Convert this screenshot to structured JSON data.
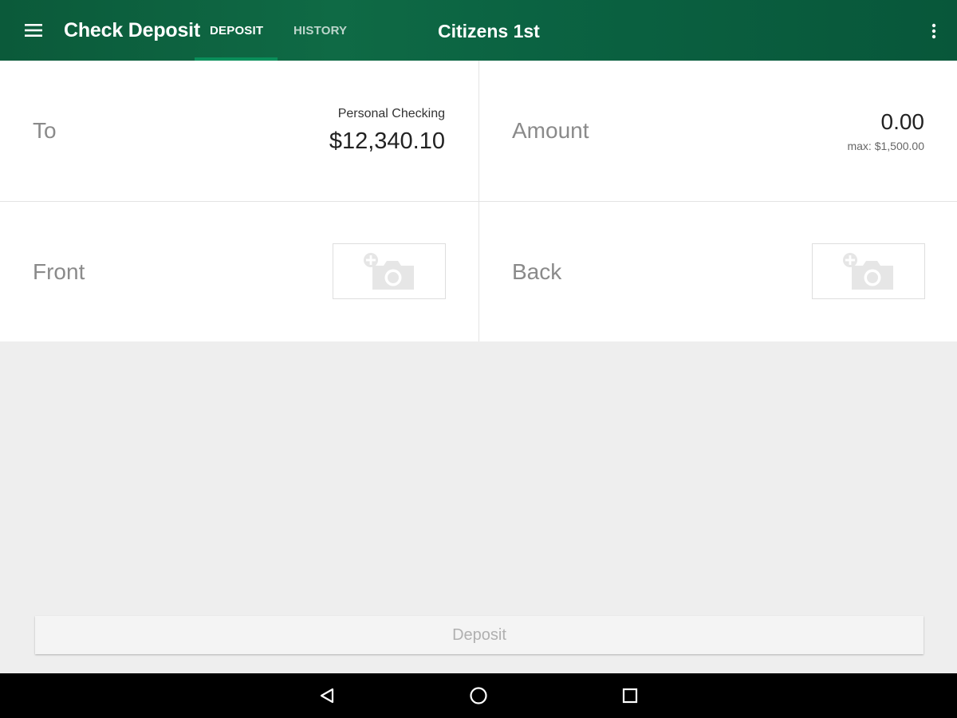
{
  "appbar": {
    "title": "Check Deposit",
    "tabs": [
      {
        "label": "DEPOSIT",
        "active": true
      },
      {
        "label": "HISTORY",
        "active": false
      }
    ],
    "bank_name": "Citizens 1st",
    "menu_icon": "hamburger-menu-icon",
    "overflow_icon": "more-vert-icon",
    "color_start": "#0b5a3a",
    "color_end": "#08573a"
  },
  "form": {
    "to": {
      "label": "To",
      "account_name": "Personal Checking",
      "balance": "$12,340.10"
    },
    "amount": {
      "label": "Amount",
      "value": "0.00",
      "max": "max: $1,500.00"
    },
    "front": {
      "label": "Front",
      "icon": "add-photo-camera-icon"
    },
    "back": {
      "label": "Back",
      "icon": "add-photo-camera-icon"
    }
  },
  "actions": {
    "deposit_label": "Deposit",
    "deposit_enabled": false
  },
  "navbar": {
    "icons": [
      "back-triangle-icon",
      "home-circle-icon",
      "recents-square-icon"
    ]
  }
}
